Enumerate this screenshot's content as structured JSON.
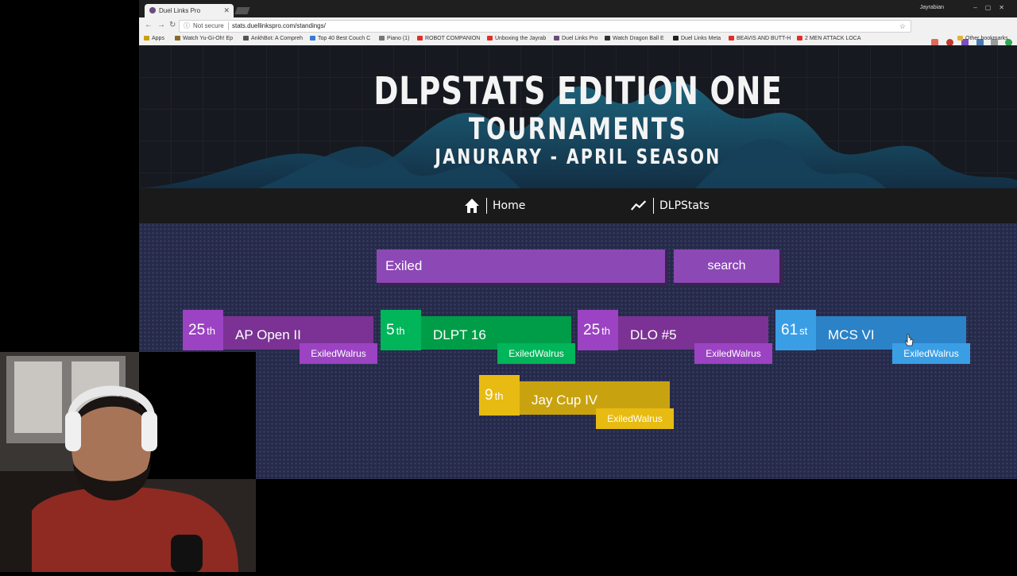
{
  "browser": {
    "tab_title": "Duel Links Pro",
    "profile_name": "Jayrabian",
    "security_label": "Not secure",
    "url": "stats.duellinkspro.com/standings/",
    "bookmarks": [
      "Apps",
      "Watch Yu-Gi-Oh! Ep",
      "AnkhBot: A Compreh",
      "Top 40 Best Couch C",
      "Piano (1)",
      "ROBOT COMPANION",
      "Unboxing the Jayrab",
      "Duel Links Pro",
      "Watch Dragon Ball E",
      "Duel Links Meta",
      "BEAVIS AND BUTT-H",
      "2 MEN ATTACK LOCA"
    ],
    "other_bookmarks": "Other bookmarks"
  },
  "hero": {
    "line1": "DLPSTATS EDITION ONE",
    "line2": "TOURNAMENTS",
    "line3": "JANURARY - APRIL SEASON"
  },
  "nav": {
    "home": "Home",
    "stats": "DLPStats"
  },
  "search": {
    "query": "Exiled",
    "button": "search"
  },
  "results": [
    {
      "rank": "25",
      "suffix": "th",
      "tournament": "AP Open II",
      "player": "ExiledWalrus"
    },
    {
      "rank": "5",
      "suffix": "th",
      "tournament": "DLPT 16",
      "player": "ExiledWalrus"
    },
    {
      "rank": "25",
      "suffix": "th",
      "tournament": "DLO #5",
      "player": "ExiledWalrus"
    },
    {
      "rank": "61",
      "suffix": "st",
      "tournament": "MCS VI",
      "player": "ExiledWalrus"
    },
    {
      "rank": "9",
      "suffix": "th",
      "tournament": "Jay Cup IV",
      "player": "ExiledWalrus"
    }
  ],
  "colors": {
    "purple_body": "#7b3294",
    "purple_accent": "#9b43c2",
    "green_body": "#009d48",
    "green_accent": "#00b55a",
    "blue_body": "#2b82c7",
    "blue_accent": "#3a9ee5",
    "gold_body": "#c9a20f",
    "gold_accent": "#e7bb12"
  }
}
